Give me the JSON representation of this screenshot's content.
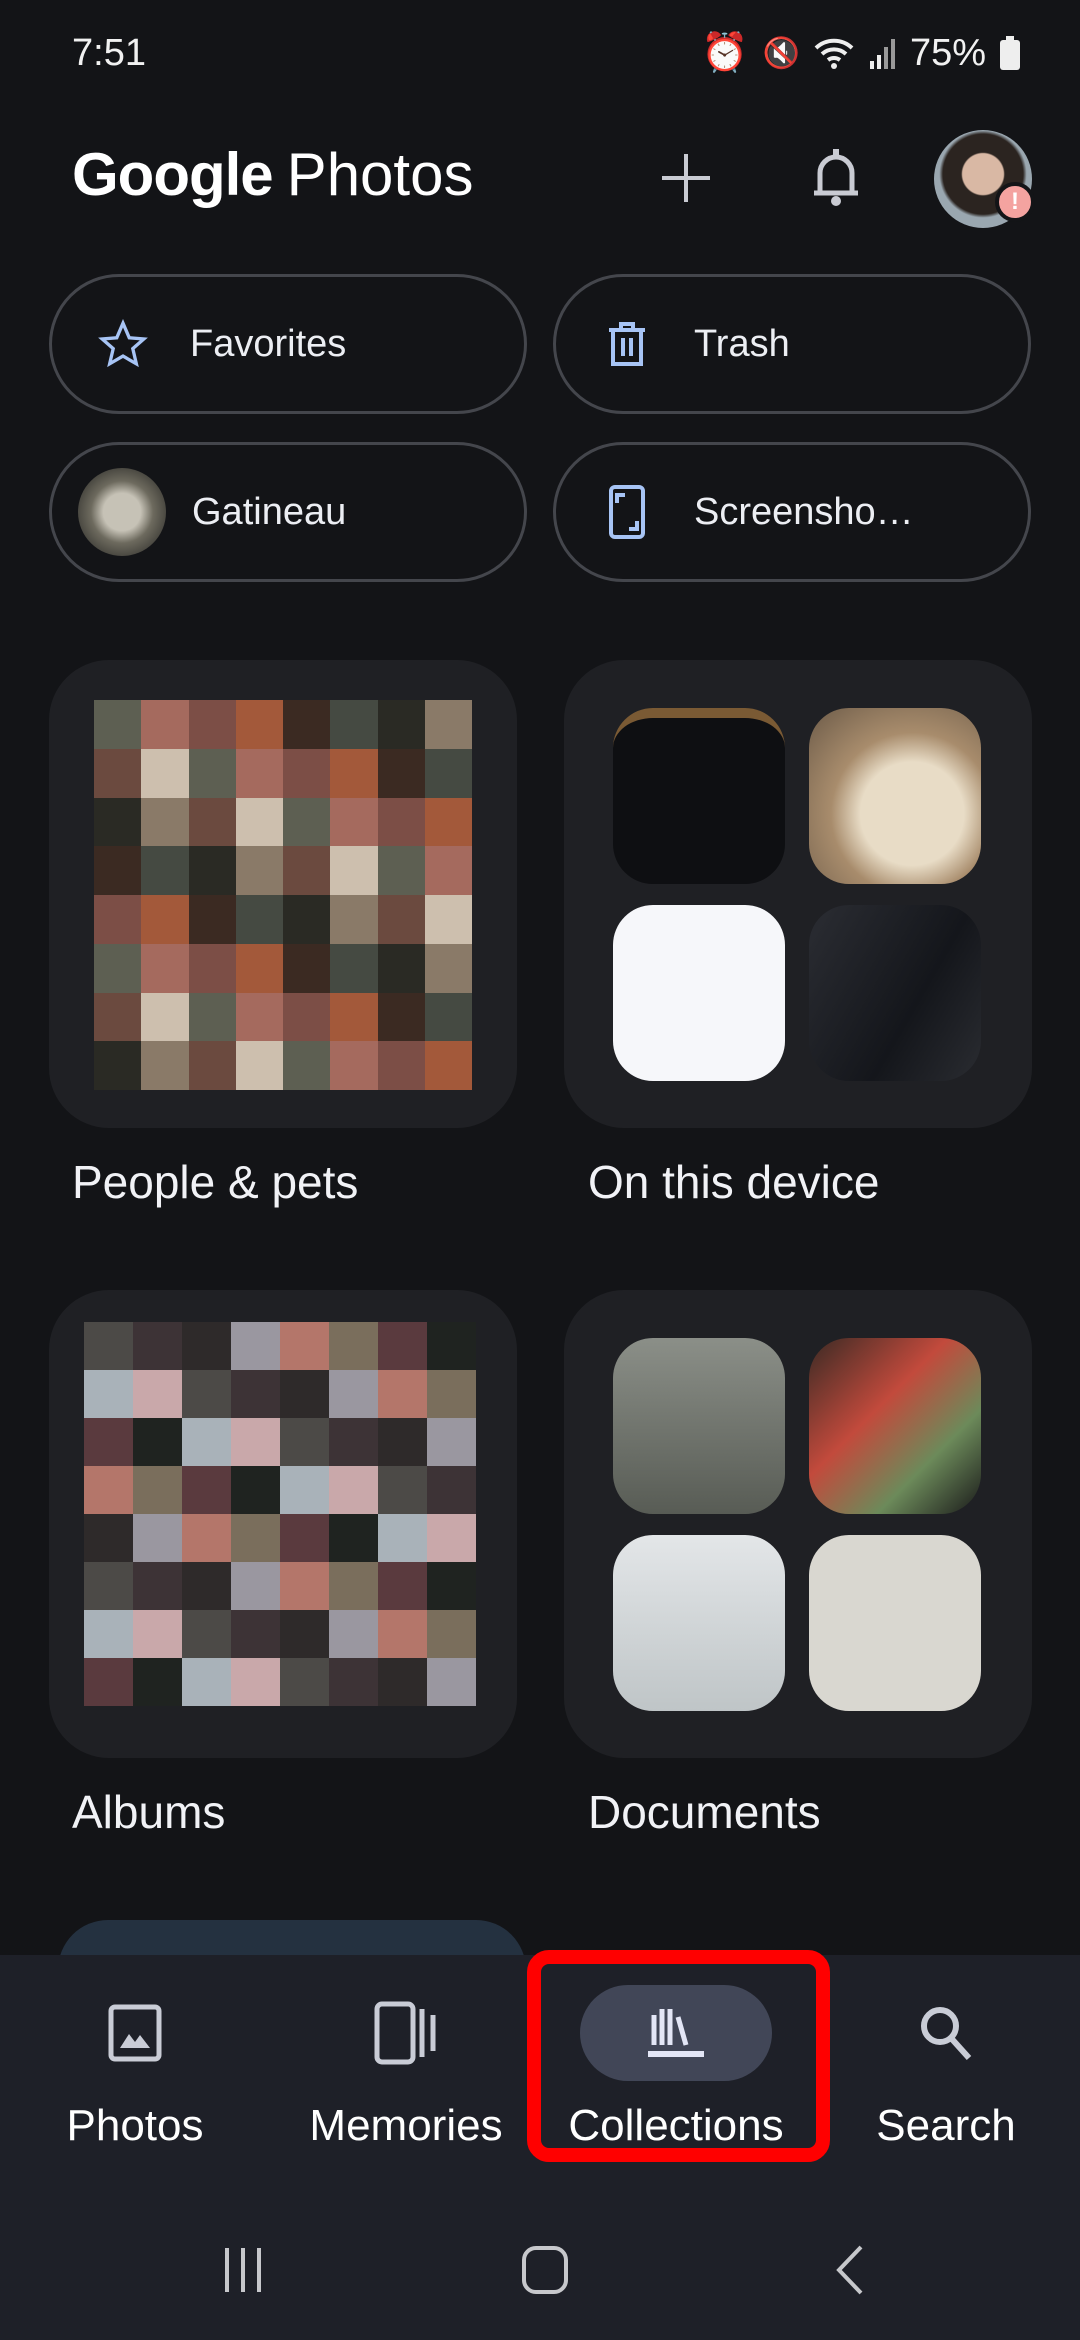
{
  "status_bar": {
    "time": "7:51",
    "battery": "75%",
    "icons": [
      "alarm-icon",
      "mute-icon",
      "wifi-icon",
      "signal-icon",
      "battery-icon"
    ]
  },
  "header": {
    "title_brand": "Google",
    "title_product": "Photos",
    "icons": [
      "plus-icon",
      "bell-icon",
      "avatar"
    ],
    "avatar_badge": "!"
  },
  "chips": [
    {
      "label": "Favorites",
      "icon": "star-icon"
    },
    {
      "label": "Trash",
      "icon": "trash-icon"
    },
    {
      "label": "Gatineau",
      "icon": "album-thumbnail"
    },
    {
      "label": "Screensho…",
      "icon": "phone-screenshot-icon"
    }
  ],
  "collections": [
    {
      "label": "People & pets"
    },
    {
      "label": "On this device"
    },
    {
      "label": "Albums"
    },
    {
      "label": "Documents"
    }
  ],
  "bottom_nav": {
    "items": [
      {
        "label": "Photos",
        "icon": "photo-icon",
        "active": false
      },
      {
        "label": "Memories",
        "icon": "memories-icon",
        "active": false
      },
      {
        "label": "Collections",
        "icon": "collections-icon",
        "active": true
      },
      {
        "label": "Search",
        "icon": "search-icon",
        "active": false
      }
    ],
    "highlight_color": "#ff0000"
  },
  "system_nav": [
    "recents-button",
    "home-button",
    "back-button"
  ]
}
